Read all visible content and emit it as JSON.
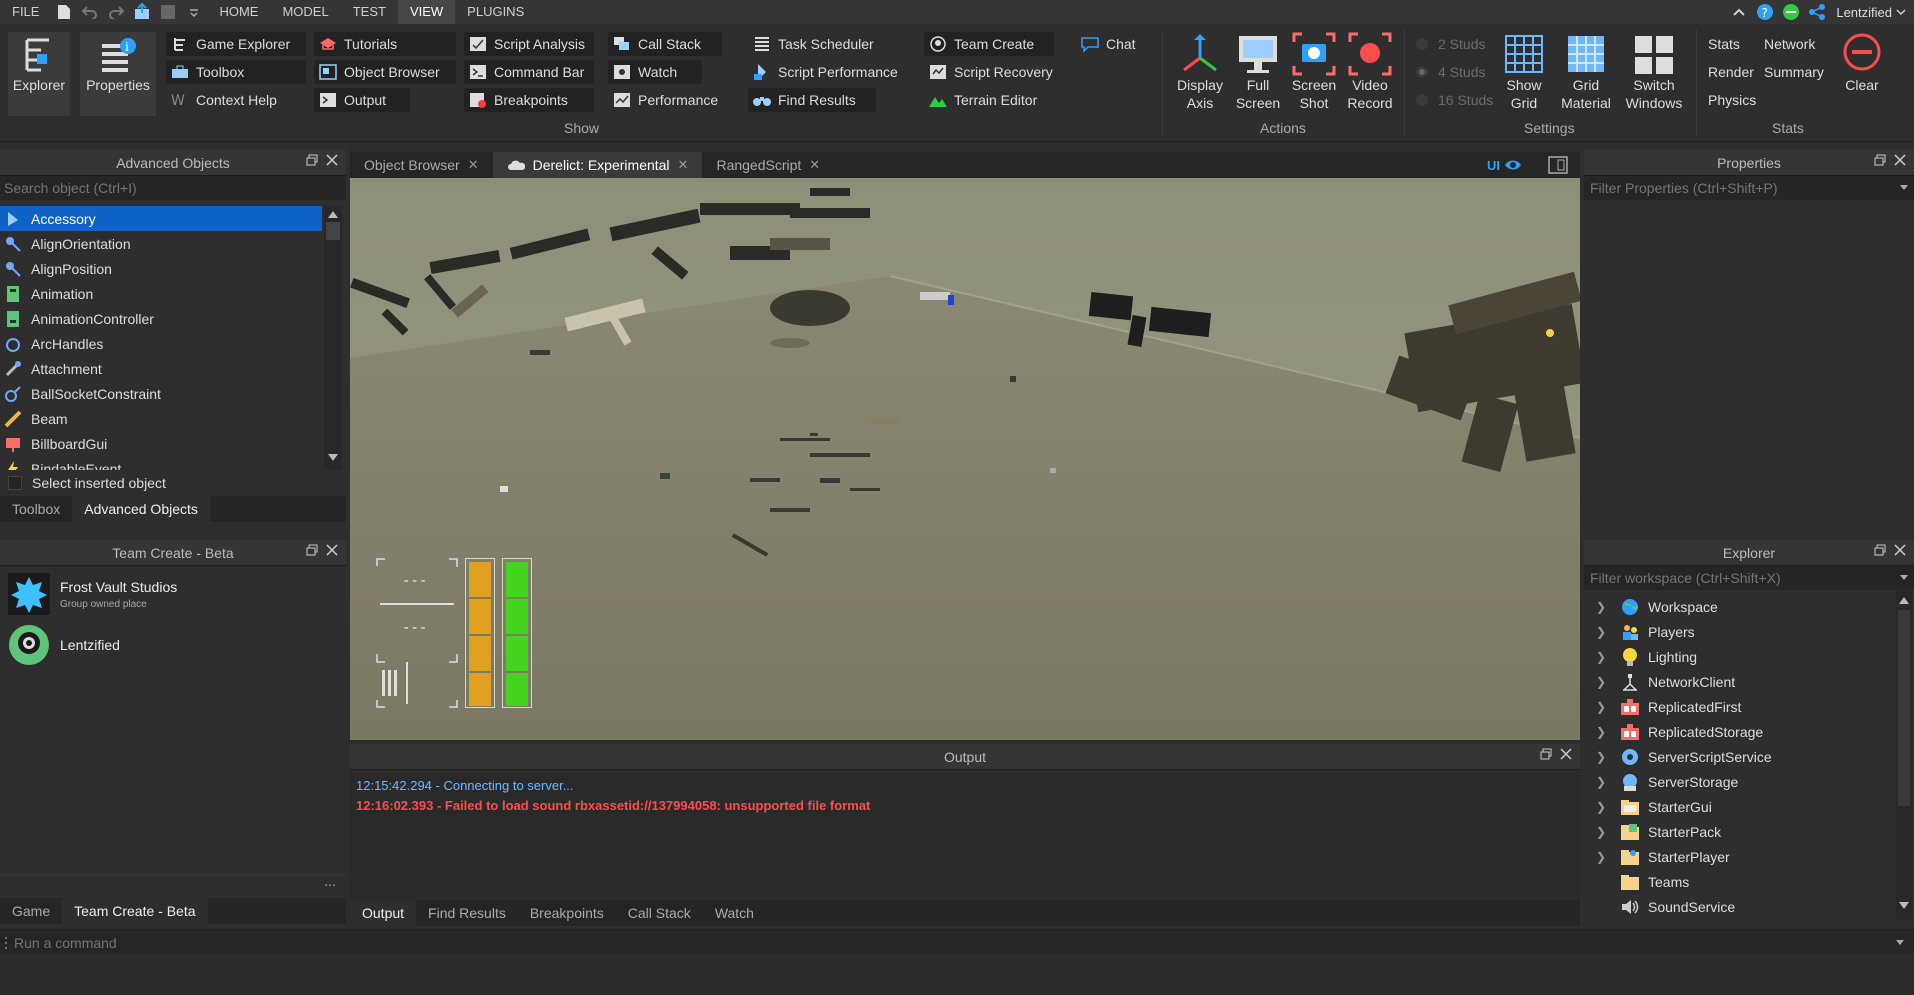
{
  "menubar": {
    "items": [
      {
        "label": "FILE",
        "active": false
      },
      {
        "label": "HOME",
        "active": false
      },
      {
        "label": "MODEL",
        "active": false
      },
      {
        "label": "TEST",
        "active": false
      },
      {
        "label": "VIEW",
        "active": true
      },
      {
        "label": "PLUGINS",
        "active": false
      }
    ],
    "user": "Lentzified"
  },
  "ribbon": {
    "explorer": "Explorer",
    "properties": "Properties",
    "show_group": "Show",
    "show_items": [
      "Game Explorer",
      "Toolbox",
      "Context Help",
      "Tutorials",
      "Object Browser",
      "Output",
      "Script Analysis",
      "Command Bar",
      "Breakpoints",
      "Call Stack",
      "Watch",
      "Performance",
      "Task Scheduler",
      "Script Performance",
      "Find Results",
      "Team Create",
      "Script Recovery",
      "Terrain Editor",
      "Chat"
    ],
    "actions_group": "Actions",
    "actions": {
      "display_axis": [
        "Display",
        "Axis"
      ],
      "full_screen": [
        "Full",
        "Screen"
      ],
      "screen_shot": [
        "Screen",
        "Shot"
      ],
      "video_record": [
        "Video",
        "Record"
      ]
    },
    "settings_group": "Settings",
    "studs": [
      "2 Studs",
      "4 Studs",
      "16 Studs"
    ],
    "settings": {
      "show_grid": [
        "Show",
        "Grid"
      ],
      "grid_material": [
        "Grid",
        "Material"
      ],
      "switch_windows": [
        "Switch",
        "Windows"
      ]
    },
    "stats_group": "Stats",
    "stats": [
      "Stats",
      "Network",
      "Render",
      "Summary",
      "Physics"
    ],
    "clear": "Clear"
  },
  "advanced_objects": {
    "title": "Advanced Objects",
    "search_placeholder": "Search object (Ctrl+I)",
    "items": [
      "Accessory",
      "AlignOrientation",
      "AlignPosition",
      "Animation",
      "AnimationController",
      "ArcHandles",
      "Attachment",
      "BallSocketConstraint",
      "Beam",
      "BillboardGui",
      "BindableEvent"
    ],
    "select_inserted": "Select inserted object",
    "tabs": [
      "Toolbox",
      "Advanced Objects"
    ]
  },
  "team_create": {
    "title": "Team Create - Beta",
    "entries": [
      {
        "name": "Frost Vault Studios",
        "sub": "Group owned place"
      },
      {
        "name": "Lentzified",
        "sub": ""
      }
    ],
    "more": "...",
    "tabs": [
      "Game",
      "Team Create - Beta"
    ]
  },
  "viewport": {
    "tabs": [
      {
        "label": "Object Browser",
        "active": false
      },
      {
        "label": "Derelict: Experimental",
        "active": true
      },
      {
        "label": "RangedScript",
        "active": false
      }
    ],
    "ui_toggle": "UI",
    "hud": {
      "dash1": "---",
      "dash2": "---"
    }
  },
  "output": {
    "title": "Output",
    "lines": [
      {
        "text": "12:15:42.294 - Connecting to server...",
        "color": "#6fb7ff"
      },
      {
        "text": "12:16:02.393 - Failed to load sound rbxassetid://137994058: unsupported file format",
        "color": "#ff4d4d"
      }
    ],
    "tabs": [
      "Output",
      "Find Results",
      "Breakpoints",
      "Call Stack",
      "Watch"
    ]
  },
  "properties": {
    "title": "Properties",
    "filter": "Filter Properties (Ctrl+Shift+P)"
  },
  "explorer": {
    "title": "Explorer",
    "filter": "Filter workspace (Ctrl+Shift+X)",
    "items": [
      {
        "label": "Workspace",
        "icon": "globe-icon",
        "expandable": true
      },
      {
        "label": "Players",
        "icon": "players-icon",
        "expandable": true
      },
      {
        "label": "Lighting",
        "icon": "lightbulb-icon",
        "expandable": true
      },
      {
        "label": "NetworkClient",
        "icon": "network-icon",
        "expandable": true
      },
      {
        "label": "ReplicatedFirst",
        "icon": "replicated-icon",
        "expandable": true
      },
      {
        "label": "ReplicatedStorage",
        "icon": "replicated-icon",
        "expandable": true
      },
      {
        "label": "ServerScriptService",
        "icon": "server-script-icon",
        "expandable": true
      },
      {
        "label": "ServerStorage",
        "icon": "server-storage-icon",
        "expandable": true
      },
      {
        "label": "StarterGui",
        "icon": "folder-icon",
        "expandable": true
      },
      {
        "label": "StarterPack",
        "icon": "folder-icon",
        "expandable": true
      },
      {
        "label": "StarterPlayer",
        "icon": "folder-icon",
        "expandable": true
      },
      {
        "label": "Teams",
        "icon": "folder-icon",
        "expandable": false
      },
      {
        "label": "SoundService",
        "icon": "sound-icon",
        "expandable": false
      }
    ]
  },
  "command_bar": {
    "placeholder": "Run a command"
  },
  "colors": {
    "selection": "#0f63c7",
    "accent": "#2ea0ff",
    "error": "#ff4d4d",
    "info": "#6fb7ff"
  }
}
